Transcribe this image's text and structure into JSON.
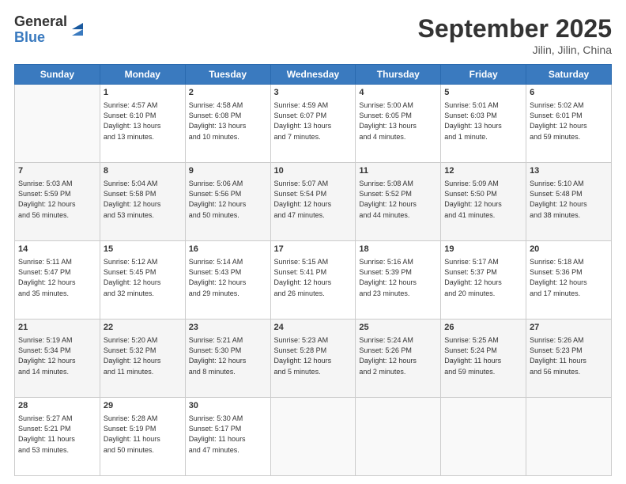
{
  "header": {
    "logo_general": "General",
    "logo_blue": "Blue",
    "title": "September 2025",
    "location": "Jilin, Jilin, China"
  },
  "days_of_week": [
    "Sunday",
    "Monday",
    "Tuesday",
    "Wednesday",
    "Thursday",
    "Friday",
    "Saturday"
  ],
  "weeks": [
    [
      {
        "day": "",
        "content": ""
      },
      {
        "day": "1",
        "content": "Sunrise: 4:57 AM\nSunset: 6:10 PM\nDaylight: 13 hours\nand 13 minutes."
      },
      {
        "day": "2",
        "content": "Sunrise: 4:58 AM\nSunset: 6:08 PM\nDaylight: 13 hours\nand 10 minutes."
      },
      {
        "day": "3",
        "content": "Sunrise: 4:59 AM\nSunset: 6:07 PM\nDaylight: 13 hours\nand 7 minutes."
      },
      {
        "day": "4",
        "content": "Sunrise: 5:00 AM\nSunset: 6:05 PM\nDaylight: 13 hours\nand 4 minutes."
      },
      {
        "day": "5",
        "content": "Sunrise: 5:01 AM\nSunset: 6:03 PM\nDaylight: 13 hours\nand 1 minute."
      },
      {
        "day": "6",
        "content": "Sunrise: 5:02 AM\nSunset: 6:01 PM\nDaylight: 12 hours\nand 59 minutes."
      }
    ],
    [
      {
        "day": "7",
        "content": "Sunrise: 5:03 AM\nSunset: 5:59 PM\nDaylight: 12 hours\nand 56 minutes."
      },
      {
        "day": "8",
        "content": "Sunrise: 5:04 AM\nSunset: 5:58 PM\nDaylight: 12 hours\nand 53 minutes."
      },
      {
        "day": "9",
        "content": "Sunrise: 5:06 AM\nSunset: 5:56 PM\nDaylight: 12 hours\nand 50 minutes."
      },
      {
        "day": "10",
        "content": "Sunrise: 5:07 AM\nSunset: 5:54 PM\nDaylight: 12 hours\nand 47 minutes."
      },
      {
        "day": "11",
        "content": "Sunrise: 5:08 AM\nSunset: 5:52 PM\nDaylight: 12 hours\nand 44 minutes."
      },
      {
        "day": "12",
        "content": "Sunrise: 5:09 AM\nSunset: 5:50 PM\nDaylight: 12 hours\nand 41 minutes."
      },
      {
        "day": "13",
        "content": "Sunrise: 5:10 AM\nSunset: 5:48 PM\nDaylight: 12 hours\nand 38 minutes."
      }
    ],
    [
      {
        "day": "14",
        "content": "Sunrise: 5:11 AM\nSunset: 5:47 PM\nDaylight: 12 hours\nand 35 minutes."
      },
      {
        "day": "15",
        "content": "Sunrise: 5:12 AM\nSunset: 5:45 PM\nDaylight: 12 hours\nand 32 minutes."
      },
      {
        "day": "16",
        "content": "Sunrise: 5:14 AM\nSunset: 5:43 PM\nDaylight: 12 hours\nand 29 minutes."
      },
      {
        "day": "17",
        "content": "Sunrise: 5:15 AM\nSunset: 5:41 PM\nDaylight: 12 hours\nand 26 minutes."
      },
      {
        "day": "18",
        "content": "Sunrise: 5:16 AM\nSunset: 5:39 PM\nDaylight: 12 hours\nand 23 minutes."
      },
      {
        "day": "19",
        "content": "Sunrise: 5:17 AM\nSunset: 5:37 PM\nDaylight: 12 hours\nand 20 minutes."
      },
      {
        "day": "20",
        "content": "Sunrise: 5:18 AM\nSunset: 5:36 PM\nDaylight: 12 hours\nand 17 minutes."
      }
    ],
    [
      {
        "day": "21",
        "content": "Sunrise: 5:19 AM\nSunset: 5:34 PM\nDaylight: 12 hours\nand 14 minutes."
      },
      {
        "day": "22",
        "content": "Sunrise: 5:20 AM\nSunset: 5:32 PM\nDaylight: 12 hours\nand 11 minutes."
      },
      {
        "day": "23",
        "content": "Sunrise: 5:21 AM\nSunset: 5:30 PM\nDaylight: 12 hours\nand 8 minutes."
      },
      {
        "day": "24",
        "content": "Sunrise: 5:23 AM\nSunset: 5:28 PM\nDaylight: 12 hours\nand 5 minutes."
      },
      {
        "day": "25",
        "content": "Sunrise: 5:24 AM\nSunset: 5:26 PM\nDaylight: 12 hours\nand 2 minutes."
      },
      {
        "day": "26",
        "content": "Sunrise: 5:25 AM\nSunset: 5:24 PM\nDaylight: 11 hours\nand 59 minutes."
      },
      {
        "day": "27",
        "content": "Sunrise: 5:26 AM\nSunset: 5:23 PM\nDaylight: 11 hours\nand 56 minutes."
      }
    ],
    [
      {
        "day": "28",
        "content": "Sunrise: 5:27 AM\nSunset: 5:21 PM\nDaylight: 11 hours\nand 53 minutes."
      },
      {
        "day": "29",
        "content": "Sunrise: 5:28 AM\nSunset: 5:19 PM\nDaylight: 11 hours\nand 50 minutes."
      },
      {
        "day": "30",
        "content": "Sunrise: 5:30 AM\nSunset: 5:17 PM\nDaylight: 11 hours\nand 47 minutes."
      },
      {
        "day": "",
        "content": ""
      },
      {
        "day": "",
        "content": ""
      },
      {
        "day": "",
        "content": ""
      },
      {
        "day": "",
        "content": ""
      }
    ]
  ]
}
